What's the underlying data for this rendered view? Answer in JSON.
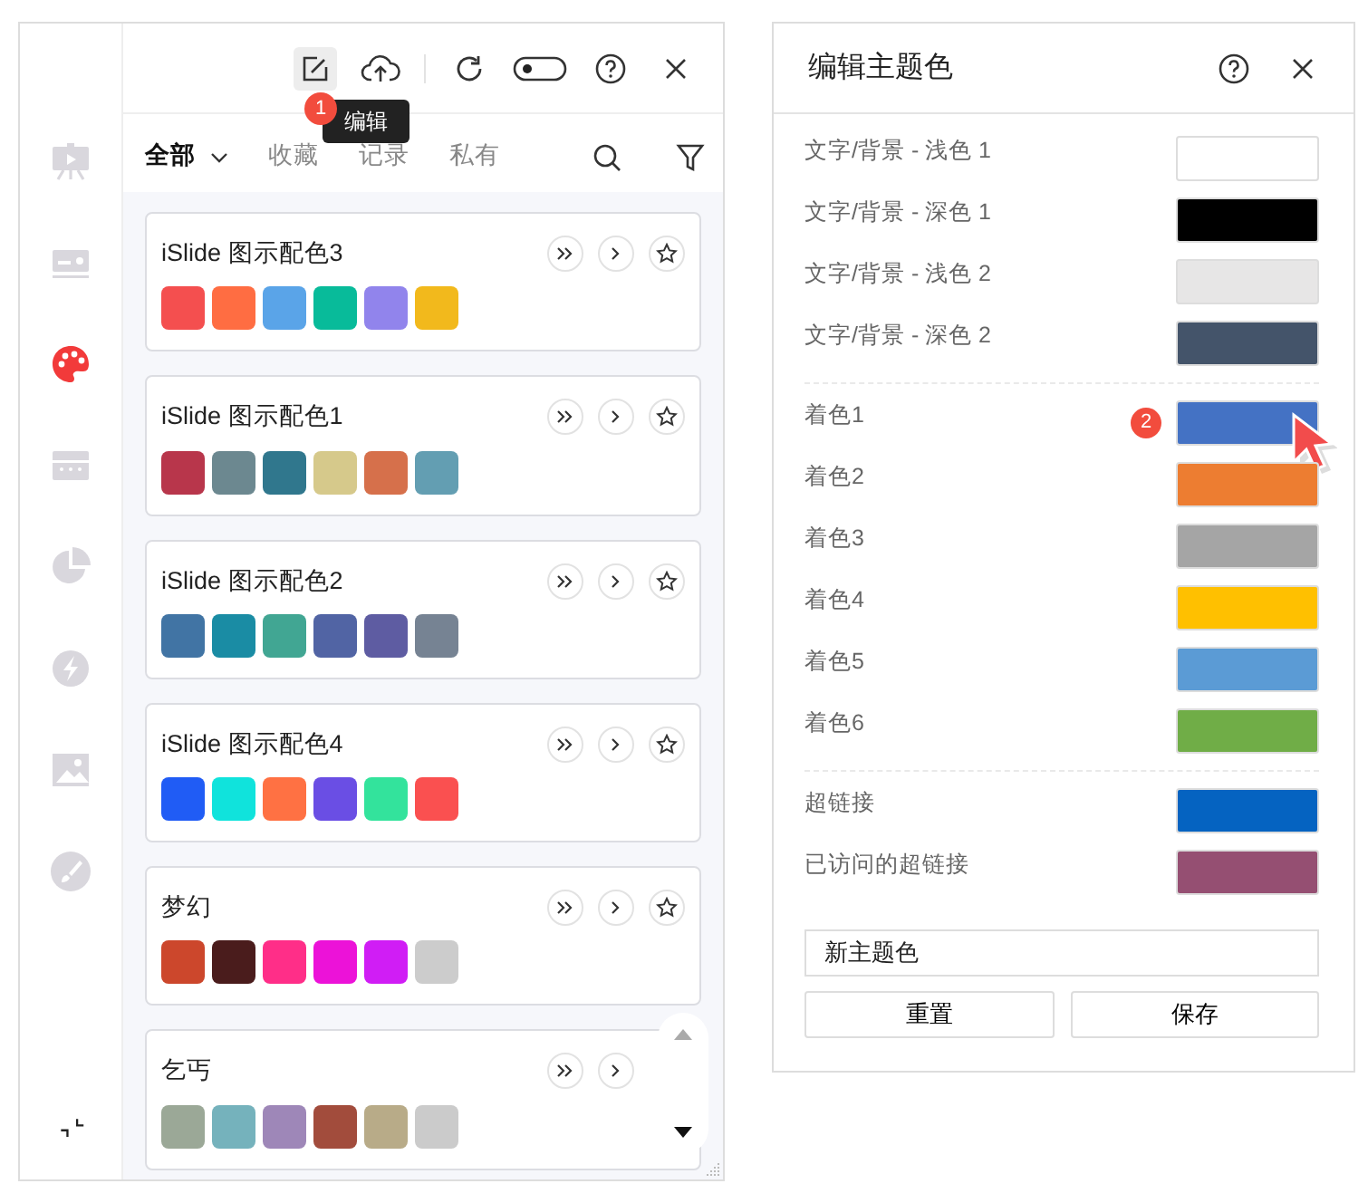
{
  "left_panel": {
    "sidebar": [
      {
        "selected": false
      },
      {
        "selected": false
      },
      {
        "selected": true
      },
      {
        "selected": false
      },
      {
        "selected": false
      },
      {
        "selected": false
      },
      {
        "selected": false
      },
      {
        "selected": false
      }
    ],
    "toolbar": {
      "badge": "1",
      "tooltip": "编辑"
    },
    "tabs": [
      {
        "label": "全部",
        "selected": true
      },
      {
        "label": "收藏",
        "selected": false
      },
      {
        "label": "记录",
        "selected": false
      },
      {
        "label": "私有",
        "selected": false
      }
    ],
    "palettes": [
      {
        "title": "iSlide 图示配色3",
        "swatches": [
          {
            "color": "#f44f4f"
          },
          {
            "color": "#ff6d42"
          },
          {
            "color": "#5aa4e8"
          },
          {
            "color": "#08bb9a"
          },
          {
            "color": "#9184ec"
          },
          {
            "color": "#f2b91c"
          }
        ]
      },
      {
        "title": "iSlide 图示配色1",
        "swatches": [
          {
            "color": "#b8364b"
          },
          {
            "color": "#6c8890"
          },
          {
            "color": "#30778d"
          },
          {
            "color": "#d6c98b"
          },
          {
            "color": "#d6704b"
          },
          {
            "color": "#639eb2"
          }
        ]
      },
      {
        "title": "iSlide 图示配色2",
        "swatches": [
          {
            "color": "#4174a4"
          },
          {
            "color": "#1a8ca4"
          },
          {
            "color": "#41a693"
          },
          {
            "color": "#5164a4"
          },
          {
            "color": "#5e5ca2"
          },
          {
            "color": "#768393"
          }
        ]
      },
      {
        "title": "iSlide 图示配色4",
        "swatches": [
          {
            "color": "#205cf5"
          },
          {
            "color": "#10e3dc"
          },
          {
            "color": "#ff7143"
          },
          {
            "color": "#6a4ee4"
          },
          {
            "color": "#33e39c"
          },
          {
            "color": "#fa5050"
          }
        ]
      },
      {
        "title": "梦幻",
        "swatches": [
          {
            "color": "#cc472c"
          },
          {
            "color": "#4a1c1c"
          },
          {
            "color": "#ff2e88"
          },
          {
            "color": "#ec12d8"
          },
          {
            "color": "#d01df5"
          },
          {
            "color": "#cccccc"
          }
        ]
      },
      {
        "title": "乞丐",
        "swatches": [
          {
            "color": "#9ba897"
          },
          {
            "color": "#75b2bc"
          },
          {
            "color": "#9e87b8"
          },
          {
            "color": "#a24c3c"
          },
          {
            "color": "#b8ab88"
          },
          {
            "color": "#cbcbcb"
          }
        ]
      }
    ]
  },
  "theme_editor": {
    "title": "编辑主题色",
    "groups": [
      [
        {
          "label": "文字/背景 - 浅色 1",
          "color": "#ffffff"
        },
        {
          "label": "文字/背景 - 深色 1",
          "color": "#000000"
        },
        {
          "label": "文字/背景 - 浅色 2",
          "color": "#e7e6e6"
        },
        {
          "label": "文字/背景 - 深色 2",
          "color": "#44546a"
        }
      ],
      [
        {
          "label": "着色1",
          "color": "#4472c4",
          "badge": "2"
        },
        {
          "label": "着色2",
          "color": "#ed7d31"
        },
        {
          "label": "着色3",
          "color": "#a5a5a5"
        },
        {
          "label": "着色4",
          "color": "#ffc000"
        },
        {
          "label": "着色5",
          "color": "#5b9bd5"
        },
        {
          "label": "着色6",
          "color": "#70ad47"
        }
      ],
      [
        {
          "label": "超链接",
          "color": "#0563c1"
        },
        {
          "label": "已访问的超链接",
          "color": "#954f72"
        }
      ]
    ],
    "name_field": "新主题色",
    "buttons": [
      "重置",
      "保存"
    ]
  }
}
